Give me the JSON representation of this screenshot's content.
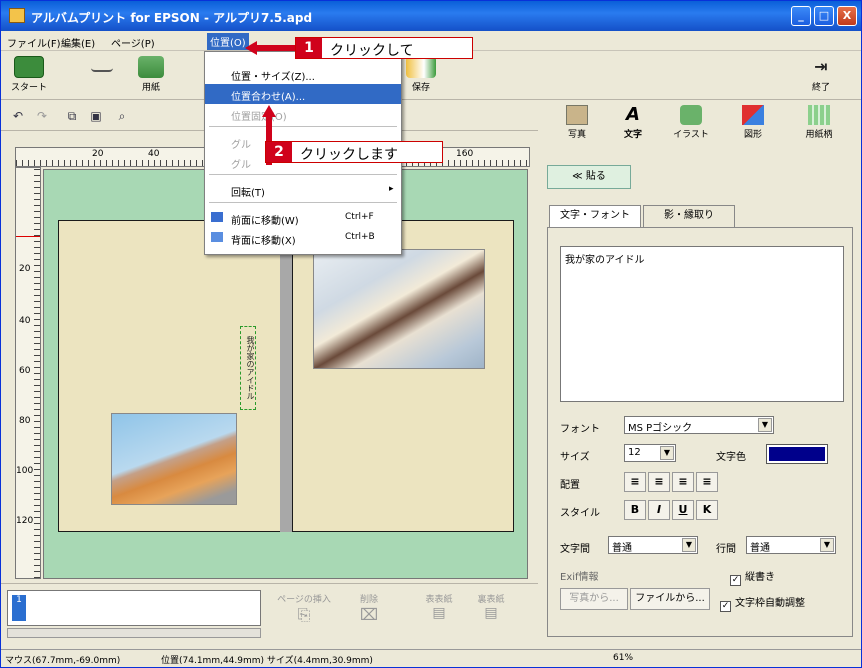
{
  "window": {
    "title": "アルバムプリント for EPSON - アルプリ7.5.apd",
    "min": "_",
    "max": "□",
    "close": "X"
  },
  "menubar": [
    "ファイル(F)",
    "編集(E)",
    "ページ(P)",
    "位置(O)"
  ],
  "toolbar": {
    "start": "スタート",
    "paper": "用紙",
    "save": "保存",
    "exit": "終了"
  },
  "ruler_h_ticks": [
    "20",
    "40",
    "160"
  ],
  "ruler_v_ticks": [
    "20",
    "40",
    "60",
    "80",
    "100",
    "120"
  ],
  "position_menu": {
    "items": [
      {
        "label": "位置・サイズ(Z)...",
        "shortcut": "",
        "state": "normal"
      },
      {
        "label": "位置合わせ(A)...",
        "shortcut": "",
        "state": "highlighted"
      },
      {
        "label": "位置固定(O)",
        "shortcut": "",
        "state": "disabled"
      },
      {
        "label": "グル",
        "shortcut": "",
        "state": "disabled"
      },
      {
        "label": "グル",
        "shortcut": "",
        "state": "disabled"
      },
      {
        "label": "回転(T)",
        "shortcut": "▸",
        "state": "normal"
      },
      {
        "label": "前面に移動(W)",
        "shortcut": "Ctrl+F",
        "state": "normal"
      },
      {
        "label": "背面に移動(X)",
        "shortcut": "Ctrl+B",
        "state": "normal"
      }
    ]
  },
  "callouts": [
    {
      "num": "1",
      "text": "クリックして"
    },
    {
      "num": "2",
      "text": "クリックします"
    }
  ],
  "canvas": {
    "vertical_text": "我が家のアイドル"
  },
  "right_tabs": [
    "写真",
    "文字",
    "イラスト",
    "図形",
    "用紙柄"
  ],
  "paste_button": "≪ 貼る",
  "panel_tabs": [
    "文字・フォント",
    "影・縁取り"
  ],
  "text_content": "我が家のアイドル",
  "font": {
    "label": "フォント",
    "value": "MS Pゴシック"
  },
  "size": {
    "label": "サイズ",
    "value": "12"
  },
  "color": {
    "label": "文字色",
    "value": "#00008b"
  },
  "align": {
    "label": "配置"
  },
  "style": {
    "label": "スタイル",
    "buttons": [
      "B",
      "I",
      "U",
      "K"
    ]
  },
  "spacing": {
    "char_label": "文字間",
    "char_value": "普通",
    "line_label": "行間",
    "line_value": "普通"
  },
  "exif": {
    "label": "Exif情報",
    "from_photo": "写真から...",
    "from_file": "ファイルから..."
  },
  "checks": {
    "vertical": "縦書き",
    "autofit": "文字枠自動調整",
    "vertical_checked": "✓",
    "autofit_checked": "✓"
  },
  "page_panel": {
    "page_number": "1",
    "insert": "ページの挿入",
    "delete": "削除",
    "front_cover": "表表紙",
    "back_cover": "裏表紙"
  },
  "status": {
    "mouse": "マウス(67.7mm,-69.0mm)",
    "position": "位置(74.1mm,44.9mm) サイズ(4.4mm,30.9mm)",
    "zoom": "61%"
  },
  "colors": {
    "titlebar": "#0a5fd8",
    "highlight": "#316ac5",
    "callout_red": "#d0021b",
    "canvas_bg": "#a8d8b4",
    "page_bg": "#ece4c0"
  }
}
